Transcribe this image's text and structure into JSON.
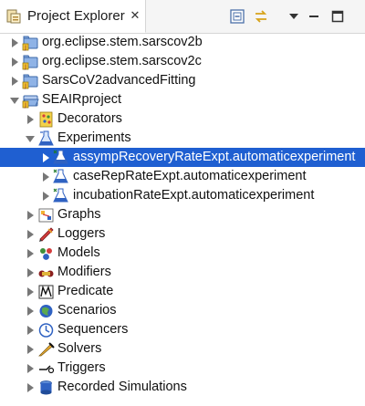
{
  "view": {
    "tab_title": "Project Explorer",
    "tab_icon": "project-explorer-icon",
    "close_glyph": "✕",
    "toolbar": [
      {
        "name": "collapse-all-button",
        "icon": "collapse-all-icon"
      },
      {
        "name": "link-with-editor-button",
        "icon": "link-with-editor-icon"
      },
      {
        "name": "view-menu-button",
        "icon": "view-menu-icon"
      },
      {
        "name": "minimize-button",
        "icon": "minimize-icon"
      },
      {
        "name": "maximize-button",
        "icon": "maximize-icon"
      }
    ]
  },
  "colors": {
    "selection": "#1f5fd1",
    "folder": "#7fa7dc"
  },
  "tree": [
    {
      "label": "org.eclipse.stem.sarscov2b",
      "icon": "project-folder-icon",
      "depth": 0,
      "expanded": false,
      "selected": false
    },
    {
      "label": "org.eclipse.stem.sarscov2c",
      "icon": "project-folder-icon",
      "depth": 0,
      "expanded": false,
      "selected": false
    },
    {
      "label": "SarsCoV2advancedFitting",
      "icon": "project-folder-icon",
      "depth": 0,
      "expanded": false,
      "selected": false
    },
    {
      "label": "SEAIRproject",
      "icon": "project-folder-open-icon",
      "depth": 0,
      "expanded": true,
      "selected": false
    },
    {
      "label": "Decorators",
      "icon": "decorators-icon",
      "depth": 1,
      "expanded": false,
      "selected": false
    },
    {
      "label": "Experiments",
      "icon": "experiments-icon",
      "depth": 1,
      "expanded": true,
      "selected": false
    },
    {
      "label": "assympRecoveryRateExpt.automaticexperiment",
      "icon": "experiment-file-icon",
      "depth": 2,
      "expanded": false,
      "selected": true
    },
    {
      "label": "caseRepRateExpt.automaticexperiment",
      "icon": "experiment-file-icon",
      "depth": 2,
      "expanded": false,
      "selected": false
    },
    {
      "label": "incubationRateExpt.automaticexperiment",
      "icon": "experiment-file-icon",
      "depth": 2,
      "expanded": false,
      "selected": false
    },
    {
      "label": "Graphs",
      "icon": "graphs-icon",
      "depth": 1,
      "expanded": false,
      "selected": false
    },
    {
      "label": "Loggers",
      "icon": "loggers-icon",
      "depth": 1,
      "expanded": false,
      "selected": false
    },
    {
      "label": "Models",
      "icon": "models-icon",
      "depth": 1,
      "expanded": false,
      "selected": false
    },
    {
      "label": "Modifiers",
      "icon": "modifiers-icon",
      "depth": 1,
      "expanded": false,
      "selected": false
    },
    {
      "label": "Predicate",
      "icon": "predicate-icon",
      "depth": 1,
      "expanded": false,
      "selected": false
    },
    {
      "label": "Scenarios",
      "icon": "scenarios-icon",
      "depth": 1,
      "expanded": false,
      "selected": false
    },
    {
      "label": "Sequencers",
      "icon": "sequencers-icon",
      "depth": 1,
      "expanded": false,
      "selected": false
    },
    {
      "label": "Solvers",
      "icon": "solvers-icon",
      "depth": 1,
      "expanded": false,
      "selected": false
    },
    {
      "label": "Triggers",
      "icon": "triggers-icon",
      "depth": 1,
      "expanded": false,
      "selected": false
    },
    {
      "label": "Recorded Simulations",
      "icon": "recorded-simulations-icon",
      "depth": 1,
      "expanded": false,
      "selected": false
    }
  ]
}
